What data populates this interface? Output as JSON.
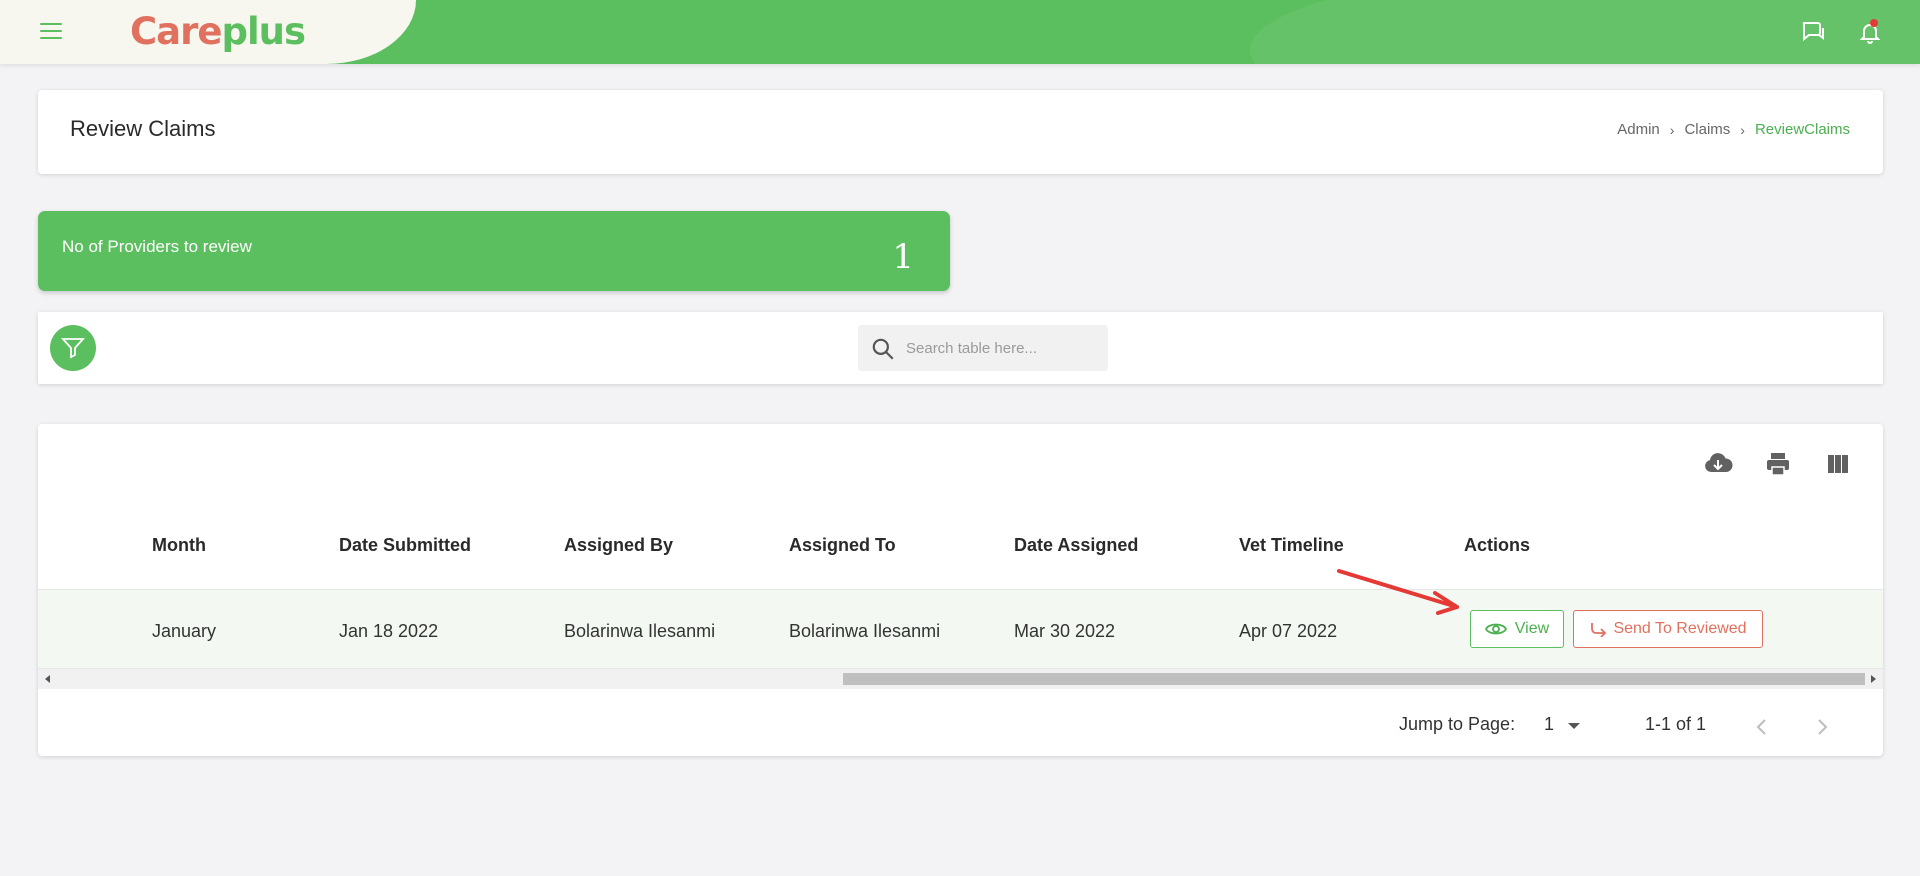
{
  "app": {
    "logo_part1": "Care",
    "logo_part2": "plus",
    "brand_color": "#5cbf5f",
    "accent_color": "#e0715e"
  },
  "topbar": {
    "icons": [
      "menu-icon",
      "chat-icon",
      "bell-icon"
    ]
  },
  "page": {
    "title": "Review Claims",
    "breadcrumb": [
      "Admin",
      "Claims",
      "ReviewClaims"
    ]
  },
  "stat": {
    "label": "No of Providers to review",
    "value": "1"
  },
  "search": {
    "placeholder": "Search table here..."
  },
  "table": {
    "toolbar_icons": [
      "download-icon",
      "print-icon",
      "columns-icon"
    ],
    "columns": [
      "Month",
      "Date Submitted",
      "Assigned By",
      "Assigned To",
      "Date Assigned",
      "Vet Timeline",
      "Actions"
    ],
    "rows": [
      {
        "month": "January",
        "date_submitted": "Jan 18 2022",
        "assigned_by": "Bolarinwa Ilesanmi",
        "assigned_to": "Bolarinwa Ilesanmi",
        "date_assigned": "Mar 30 2022",
        "vet_timeline": "Apr 07 2022",
        "view_label": "View",
        "send_label": "Send To Reviewed"
      }
    ]
  },
  "pagination": {
    "jump_label": "Jump to Page:",
    "current_page": "1",
    "range": "1-1 of 1"
  }
}
